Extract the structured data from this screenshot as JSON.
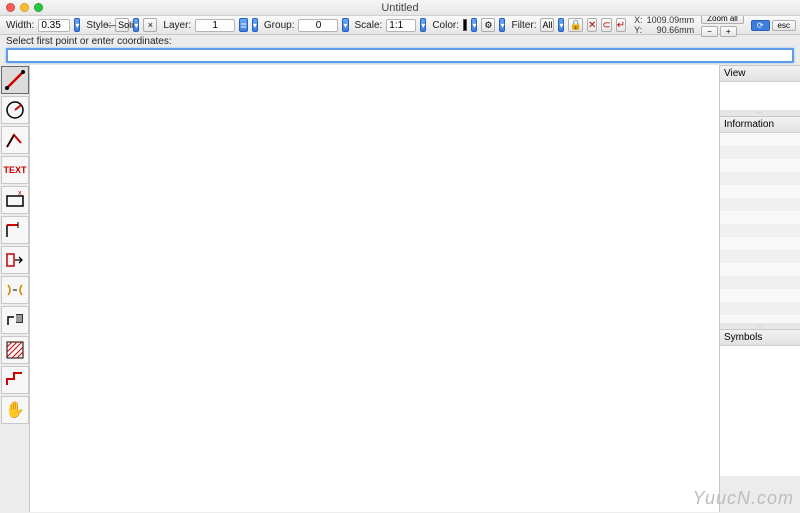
{
  "titlebar": {
    "title": "Untitled"
  },
  "toolbar": {
    "width_label": "Width:",
    "width_value": "0.35",
    "style_label": "Style:",
    "style_value": "— Solid",
    "style_x": "×",
    "layer_label": "Layer:",
    "layer_value": "1",
    "group_label": "Group:",
    "group_value": "0",
    "scale_label": "Scale:",
    "scale_value": "1:1",
    "color_label": "Color:",
    "color_value": "#000000",
    "gear": "⚙",
    "filter_label": "Filter:",
    "filter_value": "All",
    "lock_icon": "🔒",
    "del_icon": "✕",
    "lockc_icon": "⊂",
    "rev_icon": "↵",
    "x_label": "X:",
    "x_value": "1009.09mm",
    "y_label": "Y:",
    "y_value": "90.66mm",
    "zoomall": "Zoom all",
    "minus": "−",
    "plus": "+",
    "refresh": "⟳",
    "esc": "esc"
  },
  "prompt": {
    "text": "Select first point or enter coordinates:"
  },
  "tools": [
    {
      "name": "line-tool",
      "glyph": "╱"
    },
    {
      "name": "arc-tool",
      "glyph": "◔"
    },
    {
      "name": "polyline-tool",
      "glyph": "⟋"
    },
    {
      "name": "text-tool",
      "glyph": "TEXT"
    },
    {
      "name": "rect-tool",
      "glyph": "▭"
    },
    {
      "name": "dim-tool",
      "glyph": "⊢"
    },
    {
      "name": "offset-tool",
      "glyph": "⇥"
    },
    {
      "name": "mirror-tool",
      "glyph": "⇄"
    },
    {
      "name": "trim-tool",
      "glyph": "⌫"
    },
    {
      "name": "hatch-tool",
      "glyph": "▨"
    },
    {
      "name": "stair-tool",
      "glyph": "⌐"
    },
    {
      "name": "pan-tool",
      "glyph": "✋"
    }
  ],
  "panels": {
    "view": {
      "title": "View"
    },
    "info": {
      "title": "Information"
    },
    "symbols": {
      "title": "Symbols"
    }
  },
  "watermark": "YuucN.com"
}
